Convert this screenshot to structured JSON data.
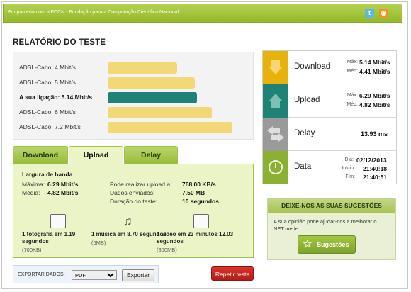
{
  "header": {
    "partner_text": "Em parceria com a FCCN - Fundação para a Computação Científica Nacional",
    "twitter_icon": "twitter-icon",
    "rss_icon": "rss-icon"
  },
  "report": {
    "title": "RELATÓRIO DO TESTE",
    "speeds": [
      {
        "label": "ADSL-Cabo: 4 Mbit/s",
        "value": 4,
        "mine": false
      },
      {
        "label": "ADSL-Cabo: 5 Mbit/s",
        "value": 5,
        "mine": false
      },
      {
        "label": "A sua ligação: 5.14 Mbit/s",
        "value": 5.14,
        "mine": true
      },
      {
        "label": "ADSL-Cabo: 6 Mbit/s",
        "value": 6,
        "mine": false
      },
      {
        "label": "ADSL-Cabo: 7.2 Mbit/s",
        "value": 7.2,
        "mine": false
      }
    ],
    "colors": {
      "reference": "#f3d877",
      "mine": "#1e8277"
    }
  },
  "tabs": [
    {
      "label": "Download"
    },
    {
      "label": "Upload"
    },
    {
      "label": "Delay"
    }
  ],
  "active_tab": "Upload",
  "upload_panel": {
    "heading": "Largura de banda",
    "max_label": "Máxima:",
    "max_value": "6.29 Mbit/s",
    "avg_label": "Média:",
    "avg_value": "4.82 Mbit/s",
    "rate_label": "Pode realizar upload a:",
    "rate_value": "768.00 KB/s",
    "sent_label": "Dados enviados:",
    "sent_value": "7.50 MB",
    "dur_label": "Duração do teste:",
    "dur_value": "10 segundos",
    "equivalents": [
      {
        "icon": "photo-icon",
        "text": "1 fotografia em 1.19 segundos",
        "size": "(700KB)"
      },
      {
        "icon": "music-icon",
        "text": "1 música em 8.70 segundos",
        "size": "(5MB)"
      },
      {
        "icon": "video-icon",
        "text": "1 vídeo em 23 minutos 12.03 segundos",
        "size": "(800MB)"
      }
    ]
  },
  "export": {
    "label": "EXPORTAR DADOS:",
    "selected": "PDF",
    "button": "Exportar"
  },
  "repeat_button": "Repetir teste",
  "results": {
    "download": {
      "name": "Download",
      "max_k": "Máx:",
      "max_v": "5.14 Mbit/s",
      "avg_k": "Méd:",
      "avg_v": "4.41 Mbit/s",
      "color": "#e8b20c"
    },
    "upload": {
      "name": "Upload",
      "max_k": "Máx:",
      "max_v": "6.29 Mbit/s",
      "avg_k": "Méd:",
      "avg_v": "4.82 Mbit/s",
      "color": "#1e8277"
    },
    "delay": {
      "name": "Delay",
      "value": "13.93 ms",
      "color": "#9a9a9a"
    },
    "date": {
      "name": "Data",
      "day_k": "Dia:",
      "day_v": "02/12/2013",
      "start_k": "Início:",
      "start_v": "21:40:18",
      "end_k": "Fim:",
      "end_v": "21:40:51",
      "color": "#8cb032"
    }
  },
  "suggestions": {
    "title": "DEIXE-NOS AS SUAS SUGESTÕES",
    "text": "A sua opinião pode ajudar-nos a melhorar o NET.mede.",
    "button": "Sugestões"
  }
}
